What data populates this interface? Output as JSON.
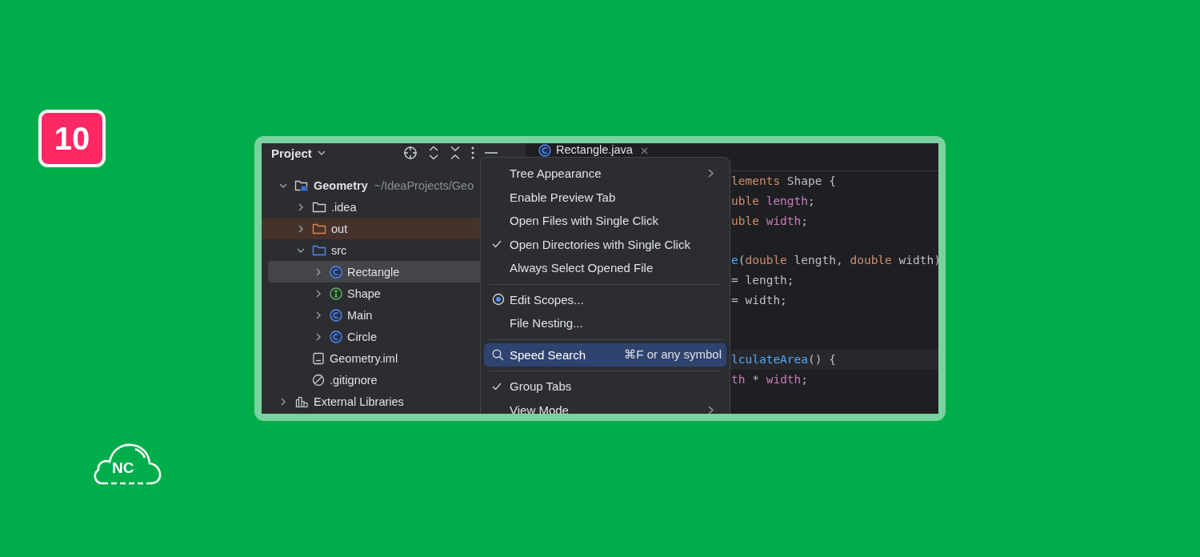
{
  "badge": "10",
  "logo": "NC",
  "project_panel": {
    "title": "Project",
    "tree": [
      {
        "label": "Geometry",
        "path": "~/IdeaProjects/Geo",
        "kind": "module",
        "expanded": true,
        "selected": false,
        "excluded": false,
        "children": [
          {
            "label": ".idea",
            "kind": "folder",
            "expanded": false,
            "selected": false,
            "excluded": false
          },
          {
            "label": "out",
            "kind": "folder",
            "expanded": false,
            "selected": false,
            "excluded": true
          },
          {
            "label": "src",
            "kind": "source",
            "expanded": true,
            "selected": false,
            "excluded": false,
            "children": [
              {
                "label": "Rectangle",
                "kind": "class",
                "expanded": false,
                "selected": true,
                "excluded": false
              },
              {
                "label": "Shape",
                "kind": "interface",
                "expanded": false,
                "selected": false,
                "excluded": false
              },
              {
                "label": "Main",
                "kind": "class",
                "expanded": false,
                "selected": false,
                "excluded": false
              },
              {
                "label": "Circle",
                "kind": "class",
                "expanded": false,
                "selected": false,
                "excluded": false
              }
            ]
          },
          {
            "label": "Geometry.iml",
            "kind": "file",
            "selected": false,
            "excluded": false
          },
          {
            "label": ".gitignore",
            "kind": "ignore",
            "selected": false,
            "excluded": false
          }
        ]
      },
      {
        "label": "External Libraries",
        "kind": "library",
        "expanded": false,
        "selected": false,
        "excluded": false
      }
    ]
  },
  "editor": {
    "tab": {
      "label": "Rectangle.java"
    },
    "lines": [
      {
        "current": false,
        "tokens": [
          {
            "text": "lements",
            "kind": "keyword"
          },
          {
            "text": " Shape {",
            "kind": "plain"
          }
        ]
      },
      {
        "current": false,
        "tokens": [
          {
            "text": "uble",
            "kind": "keyword"
          },
          {
            "text": " length",
            "kind": "field"
          },
          {
            "text": ";",
            "kind": "plain"
          }
        ]
      },
      {
        "current": false,
        "tokens": [
          {
            "text": "uble",
            "kind": "keyword"
          },
          {
            "text": " width",
            "kind": "field"
          },
          {
            "text": ";",
            "kind": "plain"
          }
        ]
      },
      {
        "current": false
      },
      {
        "current": false,
        "tokens": [
          {
            "text": "e",
            "kind": "function"
          },
          {
            "text": "(",
            "kind": "plain"
          },
          {
            "text": "double",
            "kind": "keyword"
          },
          {
            "text": " length, ",
            "kind": "plain"
          },
          {
            "text": "double",
            "kind": "keyword"
          },
          {
            "text": " width)",
            "kind": "plain"
          }
        ]
      },
      {
        "current": false,
        "tokens": [
          {
            "text": "= length;",
            "kind": "plain"
          }
        ]
      },
      {
        "current": false,
        "tokens": [
          {
            "text": "= width;",
            "kind": "plain"
          }
        ]
      },
      {
        "current": false
      },
      {
        "current": false
      },
      {
        "current": true,
        "tokens": [
          {
            "text": "lculateArea",
            "kind": "function"
          },
          {
            "text": "() {",
            "kind": "plain"
          }
        ]
      },
      {
        "current": false,
        "tokens": [
          {
            "text": "th",
            "kind": "field"
          },
          {
            "text": " * ",
            "kind": "plain"
          },
          {
            "text": "width",
            "kind": "field"
          },
          {
            "text": ";",
            "kind": "plain"
          }
        ]
      }
    ]
  },
  "menu": [
    {
      "kind": "item",
      "label": "Tree Appearance",
      "checked": false,
      "submenu": true,
      "selected": false
    },
    {
      "kind": "item",
      "label": "Enable Preview Tab",
      "checked": false,
      "submenu": false,
      "selected": false
    },
    {
      "kind": "item",
      "label": "Open Files with Single Click",
      "checked": false,
      "submenu": false,
      "selected": false
    },
    {
      "kind": "item",
      "label": "Open Directories with Single Click",
      "checked": true,
      "submenu": false,
      "selected": false
    },
    {
      "kind": "item",
      "label": "Always Select Opened File",
      "checked": false,
      "submenu": false,
      "selected": false
    },
    {
      "kind": "separator"
    },
    {
      "kind": "scope",
      "label": "Edit Scopes...",
      "checked": false,
      "submenu": false,
      "selected": false
    },
    {
      "kind": "item",
      "label": "File Nesting...",
      "checked": false,
      "submenu": false,
      "selected": false
    },
    {
      "kind": "separator"
    },
    {
      "kind": "search",
      "label": "Speed Search",
      "shortcut": "⌘F or any symbol",
      "checked": false,
      "submenu": false,
      "selected": true
    },
    {
      "kind": "separator"
    },
    {
      "kind": "item",
      "label": "Group Tabs",
      "checked": true,
      "submenu": false,
      "selected": false
    },
    {
      "kind": "item",
      "label": "View Mode",
      "checked": false,
      "submenu": true,
      "selected": false
    }
  ]
}
